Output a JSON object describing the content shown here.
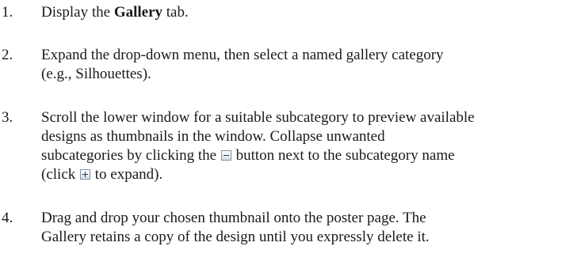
{
  "steps": [
    {
      "number": "1.",
      "pre": "Display the ",
      "bold": "Gallery",
      "post": " tab."
    },
    {
      "number": "2.",
      "line1": "Expand the drop-down menu, then select a named gallery category",
      "line2": "(e.g., Silhouettes)."
    },
    {
      "number": "3.",
      "line1": "Scroll the lower window for a suitable subcategory to preview available",
      "line2": "designs as thumbnails in the window. Collapse unwanted",
      "line3_pre": "subcategories by clicking the ",
      "line3_post": " button next to the subcategory name",
      "line4_pre": "(click ",
      "line4_post": " to expand)."
    },
    {
      "number": "4.",
      "line1": "Drag and drop your chosen thumbnail onto the poster page. The",
      "line2": "Gallery retains a copy of the design until you expressly delete it."
    }
  ],
  "icons": {
    "collapse": "collapse-minus-icon",
    "expand": "expand-plus-icon"
  }
}
